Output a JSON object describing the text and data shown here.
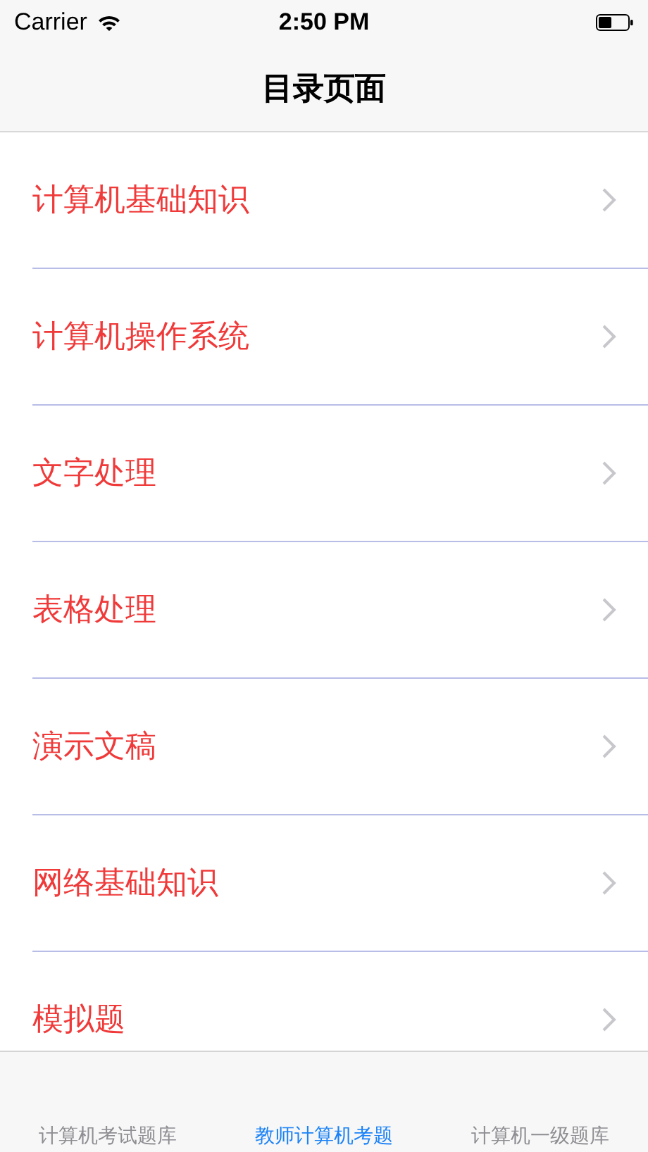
{
  "status_bar": {
    "carrier": "Carrier",
    "time": "2:50 PM"
  },
  "nav_bar": {
    "title": "目录页面"
  },
  "list": {
    "items": [
      {
        "label": "计算机基础知识"
      },
      {
        "label": "计算机操作系统"
      },
      {
        "label": "文字处理"
      },
      {
        "label": "表格处理"
      },
      {
        "label": "演示文稿"
      },
      {
        "label": "网络基础知识"
      },
      {
        "label": "模拟题"
      }
    ]
  },
  "tab_bar": {
    "tabs": [
      {
        "label": "计算机考试题库",
        "selected": false
      },
      {
        "label": "教师计算机考题",
        "selected": true
      },
      {
        "label": "计算机一级题库",
        "selected": false
      }
    ]
  }
}
